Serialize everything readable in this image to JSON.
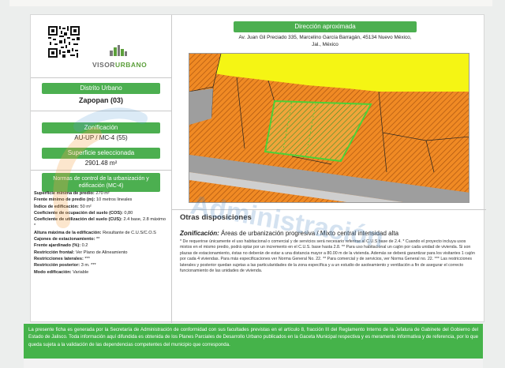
{
  "header": {
    "logo_text": "VISOR",
    "logo_text_accent": "URBANO"
  },
  "distrito": {
    "label": "Distrito Urbano",
    "value": "Zapopan  (03)"
  },
  "zonificacion": {
    "label": "Zonificación",
    "value": "AU-UP / MC-4 (55)"
  },
  "superficie": {
    "label": "Superficie seleccionada",
    "value": "2901.48 m²"
  },
  "normas": {
    "heading": "Normas de control de la urbanización y edificación (MC-4)",
    "items": [
      {
        "label": "Superficie mínima de predio:",
        "value": "270 m²"
      },
      {
        "label": "Frente mínimo de predio (m):",
        "value": "10 metros lineales"
      },
      {
        "label": "Índice de edificación:",
        "value": "50 m²"
      },
      {
        "label": "Coeficiente de ocupación del suelo (COS):",
        "value": "0,80"
      },
      {
        "label": "Coeficiente de utilización del suelo (CUS):",
        "value": "2.4 base, 2.8 máximo *"
      },
      {
        "label": "Altura máxima de la edificación:",
        "value": "Resultante de C.U.S/C.O.S"
      },
      {
        "label": "Cajones de estacionamiento:",
        "value": "**"
      },
      {
        "label": "Frente ajardinado (%):",
        "value": "0.2"
      },
      {
        "label": "Restricción frontal:",
        "value": "Ver Plano de Alineamiento"
      },
      {
        "label": "Restricciones laterales:",
        "value": "***"
      },
      {
        "label": "Restricción posterior:",
        "value": "3 m. ***"
      },
      {
        "label": "Modo edificación:",
        "value": "Variable"
      }
    ]
  },
  "direccion": {
    "label": "Dirección aproximada",
    "value": "Av. Juan Gil Preciado 335, Marcelino García Barragán, 45134 Nuevo México, Jal., México"
  },
  "otras": {
    "heading": "Otras disposiciones",
    "zonificacion_label": "Zonificación:",
    "zonificacion_value": "Áreas de urbanización progresiva / Mixto central intensidad alta",
    "notes": "* De requerirse únicamente el uso habitacional o comercial y de servicios será necesario referirse al C.U.S base de 2.4. * Cuando el proyecto incluya usos mixtos en el mismo predio, podrá optar por un incremento en el C.U.S. base hasta 2.8. ** Para uso habitacional un cajón por cada unidad de vivienda. Si son plazas de estacionamiento, éstas no deberán de estar a una distancia mayor a 80.00 m de la vivienda. Además se deberá garantizar para los visitantes 1 cajón por cada 4 viviendas. Para más especificaciones ver Norma General No. 22. ** Para comercial y de servicios, ver Norma General no. 22. *** Las restricciones laterales y posterior quedan sujetas a las particularidades de la zona específica y a un estudio de asoleamiento y ventilación a fin de asegurar el correcto funcionamiento de las unidades de vivienda."
  },
  "footer": {
    "text": "La presente ficha es generada por la Secretaría de Administración de conformidad con sus facultades previstas en el artículo 8, fracción III del Reglamento Interno de la Jefatura de Gabinete del Gobierno del Estado de Jalisco. Toda información aquí difundida es obtenida de los Planes Parciales de Desarrollo Urbano publicados en la Gaceta Municipal respectiva y es meramente informativa y de referencia, por lo que queda sujeta a la validación de las dependencias competentes del municipio que corresponda."
  },
  "watermark": {
    "text": "Administración"
  },
  "colors": {
    "green": "#4caf50",
    "map_yellow": "#f5f514",
    "map_orange": "#f08a24",
    "map_gray": "#9e9e9e"
  }
}
